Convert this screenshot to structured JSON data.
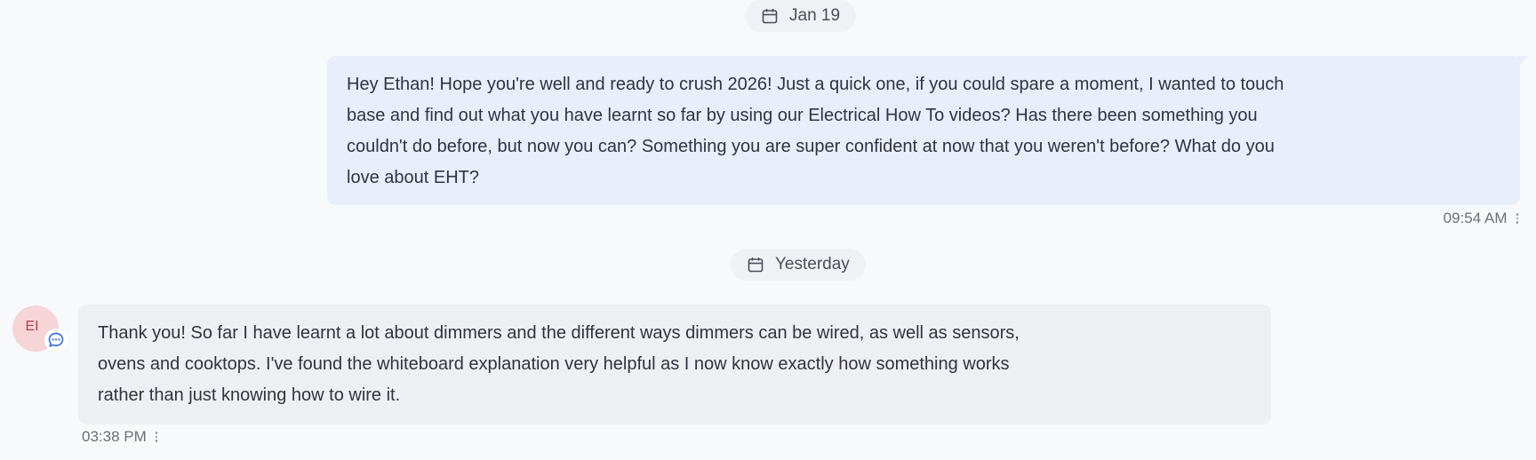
{
  "thread": {
    "dividers": [
      {
        "label": "Jan 19",
        "icon": "calendar-icon"
      },
      {
        "label": "Yesterday",
        "icon": "calendar-icon"
      }
    ],
    "messages": [
      {
        "direction": "outgoing",
        "lines": [
          "Hey Ethan! Hope you're well and ready to crush 2026! Just a quick one, if you could spare a moment, I wanted to touch",
          "base and find out what you have learnt so far by using our Electrical How To videos? Has there been something you",
          "couldn't do before, but now you can? Something you are super confident at now that you weren't before? What do you",
          "love about EHT?"
        ],
        "time": "09:54 AM",
        "menu_icon": "kebab-menu-icon"
      },
      {
        "direction": "incoming",
        "avatar_initials": "EI",
        "channel_icon": "chat-bubble-icon",
        "lines": [
          "Thank you! So far I have learnt a lot about dimmers and the different ways dimmers can be wired, as well as sensors,",
          "ovens and cooktops. I've found the whiteboard explanation very helpful as I now know exactly how something works",
          "rather than just knowing how to wire it."
        ],
        "time": "03:38 PM",
        "menu_icon": "kebab-menu-icon"
      }
    ]
  },
  "colors": {
    "background": "#f8f9fb",
    "outgoing_bubble": "#e9eefb",
    "incoming_bubble": "#eeeff2",
    "avatar_bg": "#f6d4d7",
    "avatar_text": "#b04050",
    "badge_icon": "#3b6fe0"
  }
}
